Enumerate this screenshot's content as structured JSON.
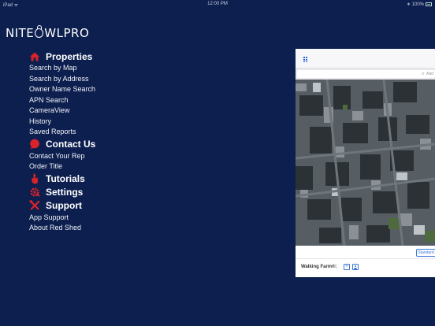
{
  "status_bar": {
    "left": "iPad ᯤ",
    "time": "12:00 PM",
    "right": "∗ 100%"
  },
  "logo": {
    "prefix": "NITE",
    "suffix": "WLPRO"
  },
  "colors": {
    "background": "#0d1f4f",
    "accent_red": "#d8232a",
    "link_blue": "#3b78d8"
  },
  "menu": {
    "properties": {
      "label": "Properties",
      "icon": "house-icon",
      "items": [
        "Search by Map",
        "Search by Address",
        "Owner Name Search",
        "APN Search",
        "CameraView",
        "History",
        "Saved Reports"
      ]
    },
    "contact": {
      "label": "Contact Us",
      "icon": "chat-bubble-icon",
      "items": [
        "Contact Your Rep",
        "Order Title"
      ]
    },
    "tutorials": {
      "label": "Tutorials",
      "icon": "pointing-hand-icon"
    },
    "settings": {
      "label": "Settings",
      "icon": "gear-icon"
    },
    "support": {
      "label": "Support",
      "icon": "tools-icon",
      "items": [
        "App Support",
        "About Red Shed"
      ]
    }
  },
  "preview": {
    "search_placeholder": "Add",
    "map_mode_button": "Standard",
    "walking_farm_label": "Walking Farm®:"
  }
}
